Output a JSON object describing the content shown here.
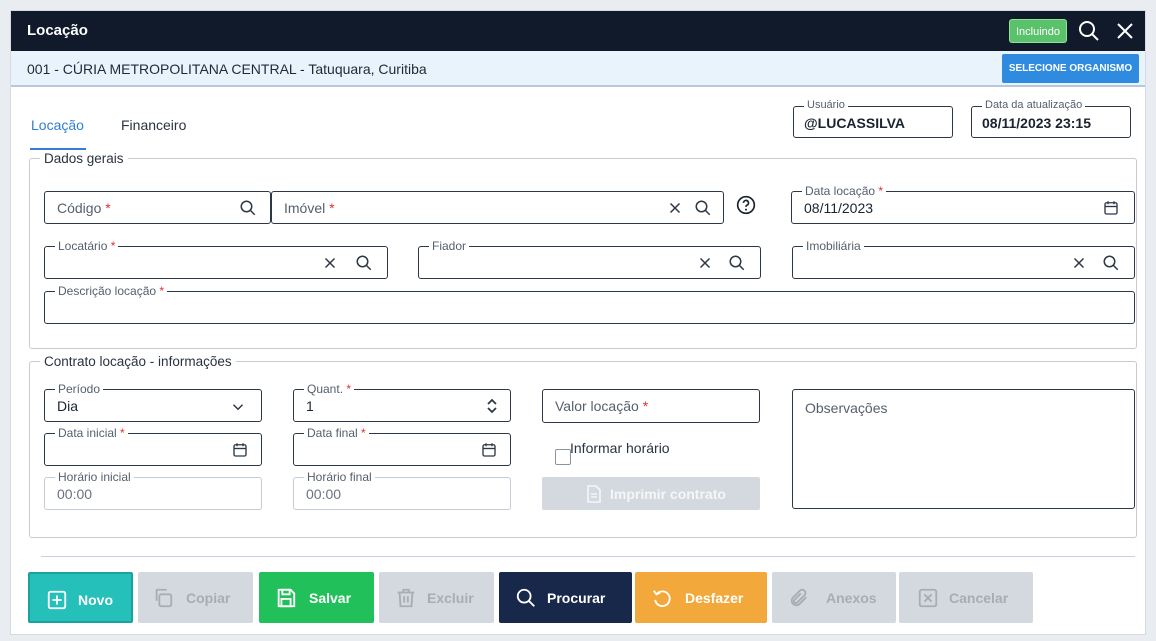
{
  "window": {
    "title": "Locação",
    "status_badge": "Incluindo",
    "org_line": "001 - CÚRIA METROPOLITANA CENTRAL - Tatuquara, Curitiba",
    "select_org_label": "SELECIONE ORGANISMO"
  },
  "tabs": [
    {
      "label": "Locação",
      "active": true
    },
    {
      "label": "Financeiro",
      "active": false
    }
  ],
  "meta": {
    "user_label": "Usuário",
    "user_value": "@LUCASSILVA",
    "updated_label": "Data da atualização",
    "updated_value": "08/11/2023 23:15"
  },
  "general": {
    "legend": "Dados gerais",
    "codigo_ph": "Código",
    "imovel_ph": "Imóvel",
    "data_locacao_label": "Data locação",
    "data_locacao_value": "08/11/2023",
    "locatario_label": "Locatário",
    "fiador_label": "Fiador",
    "imobiliaria_label": "Imobiliária",
    "descricao_label": "Descrição locação",
    "required_mark": "*"
  },
  "contract": {
    "legend": "Contrato locação - informações",
    "periodo_label": "Período",
    "periodo_value": "Dia",
    "quant_label": "Quant.",
    "quant_value": "1",
    "valor_ph": "Valor locação",
    "observacoes_ph": "Observações",
    "data_inicial_label": "Data inicial",
    "data_final_label": "Data final",
    "informar_horario_label": "Informar horário",
    "horario_inicial_label": "Horário inicial",
    "horario_inicial_value": "00:00",
    "horario_final_label": "Horário final",
    "horario_final_value": "00:00",
    "imprimir_label": "Imprimir contrato"
  },
  "actions": {
    "novo": "Novo",
    "copiar": "Copiar",
    "salvar": "Salvar",
    "excluir": "Excluir",
    "procurar": "Procurar",
    "desfazer": "Desfazer",
    "anexos": "Anexos",
    "cancelar": "Cancelar"
  },
  "colors": {
    "titlebar": "#101a2b",
    "accent": "#2f7fd3",
    "novo": "#26c0bb",
    "salvar": "#22c05a",
    "procurar": "#17284a",
    "desfazer": "#f2a83b",
    "disabled": "#d4d9df",
    "required": "#e03030"
  }
}
